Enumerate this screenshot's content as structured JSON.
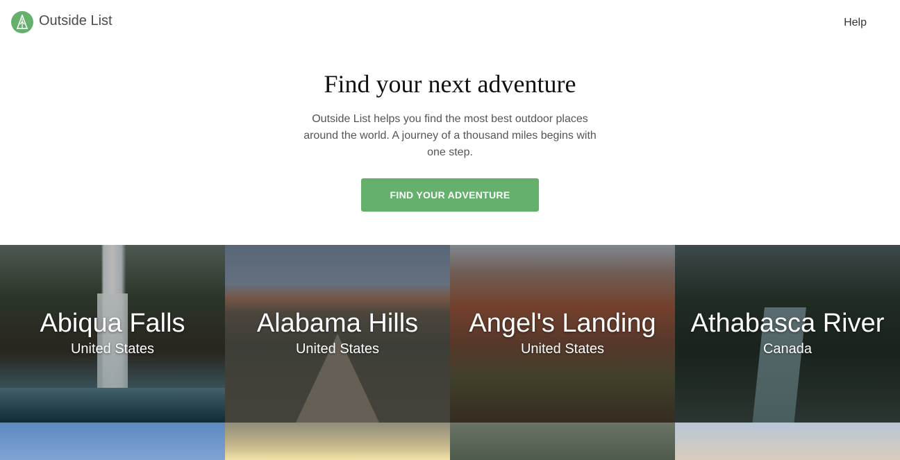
{
  "header": {
    "brand": "Outside List",
    "logo_icon": "tree-tent-icon",
    "help_label": "Help"
  },
  "hero": {
    "title": "Find your next adventure",
    "description": "Outside List helps you find the most best outdoor places around the world. A journey of a thousand miles begins with one step.",
    "cta_label": "FIND YOUR ADVENTURE"
  },
  "places": [
    {
      "name": "Abiqua Falls",
      "country": "United States"
    },
    {
      "name": "Alabama Hills",
      "country": "United States"
    },
    {
      "name": "Angel's Landing",
      "country": "United States"
    },
    {
      "name": "Athabasca River",
      "country": "Canada"
    }
  ],
  "colors": {
    "accent": "#66b06e",
    "text": "#333333"
  }
}
